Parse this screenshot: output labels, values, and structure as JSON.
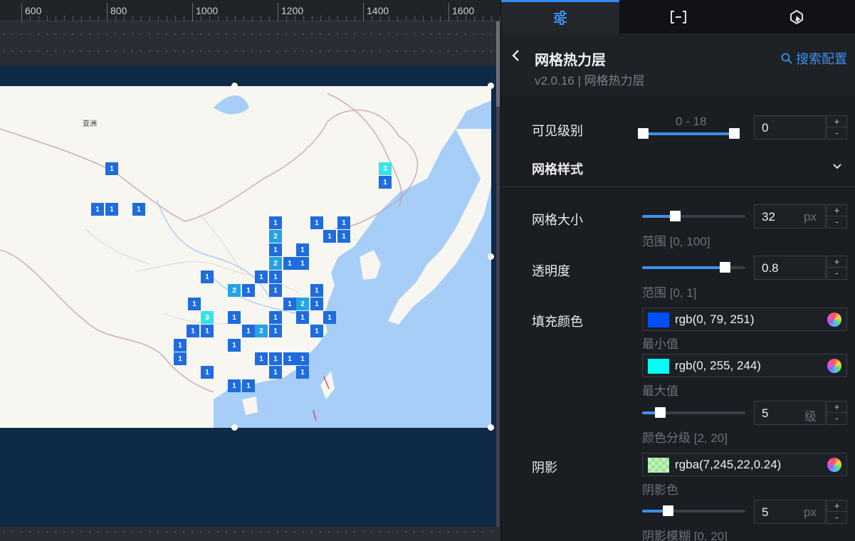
{
  "ruler": {
    "ticks": [
      "600",
      "800",
      "1000",
      "1200",
      "1400",
      "1600"
    ]
  },
  "map": {
    "region_label": "亚洲",
    "grid_cells": [
      {
        "v": "1"
      },
      {
        "v": "3"
      },
      {
        "v": "1"
      },
      {
        "v": "1"
      },
      {
        "v": "1"
      },
      {
        "v": "1"
      },
      {
        "v": "1"
      },
      {
        "v": "1"
      },
      {
        "v": "1"
      },
      {
        "v": "2"
      },
      {
        "v": "1"
      },
      {
        "v": "1"
      },
      {
        "v": "1"
      },
      {
        "v": "1"
      },
      {
        "v": "2"
      },
      {
        "v": "1"
      },
      {
        "v": "1"
      },
      {
        "v": "1"
      },
      {
        "v": "1"
      },
      {
        "v": "1"
      },
      {
        "v": "2"
      },
      {
        "v": "1"
      },
      {
        "v": "1"
      },
      {
        "v": "1"
      },
      {
        "v": "1"
      },
      {
        "v": "1"
      },
      {
        "v": "2"
      },
      {
        "v": "1"
      },
      {
        "v": "3"
      },
      {
        "v": "1"
      },
      {
        "v": "1"
      },
      {
        "v": "1"
      },
      {
        "v": "1"
      },
      {
        "v": "1"
      },
      {
        "v": "1"
      },
      {
        "v": "1"
      },
      {
        "v": "2"
      },
      {
        "v": "1"
      },
      {
        "v": "1"
      },
      {
        "v": "1"
      },
      {
        "v": "1"
      },
      {
        "v": "1"
      },
      {
        "v": "1"
      },
      {
        "v": "1"
      },
      {
        "v": "1"
      },
      {
        "v": "1"
      },
      {
        "v": "1"
      },
      {
        "v": "1"
      },
      {
        "v": "1"
      },
      {
        "v": "1"
      },
      {
        "v": "1"
      }
    ]
  },
  "panel": {
    "tabs": [
      {
        "icon": "sliders-icon"
      },
      {
        "icon": "bracket-icon"
      },
      {
        "icon": "interaction-icon"
      }
    ],
    "title": "网格热力层",
    "subtitle": "v2.0.16 | 网格热力层",
    "search_label": "搜索配置",
    "visible_level": {
      "label": "可见级别",
      "range_text": "0 - 18",
      "value": "0",
      "min": 0,
      "max": 18
    },
    "grid_style": {
      "label": "网格样式"
    },
    "grid_size": {
      "label": "网格大小",
      "value": "32",
      "unit": "px",
      "hint": "范围 [0, 100]",
      "level": 0.32
    },
    "opacity": {
      "label": "透明度",
      "value": "0.8",
      "hint": "范围 [0, 1]",
      "level": 0.8
    },
    "fill_color": {
      "label": "填充颜色",
      "min_color": "rgb(0, 79, 251)",
      "min_hex": "#004ffb",
      "min_label": "最小值",
      "max_color": "rgb(0, 255, 244)",
      "max_hex": "#00fff4",
      "max_label": "最大值"
    },
    "color_levels": {
      "value": "5",
      "unit": "级",
      "hint": "颜色分级 [2, 20]",
      "level": 0.17
    },
    "shadow": {
      "label": "阴影",
      "color": "rgba(7,245,22,0.24)",
      "color_label": "阴影色",
      "blur_value": "5",
      "blur_unit": "px",
      "blur_hint": "阴影模糊 [0, 20]",
      "blur_level": 0.25
    },
    "stepper": {
      "plus": "+",
      "minus": "-"
    }
  }
}
